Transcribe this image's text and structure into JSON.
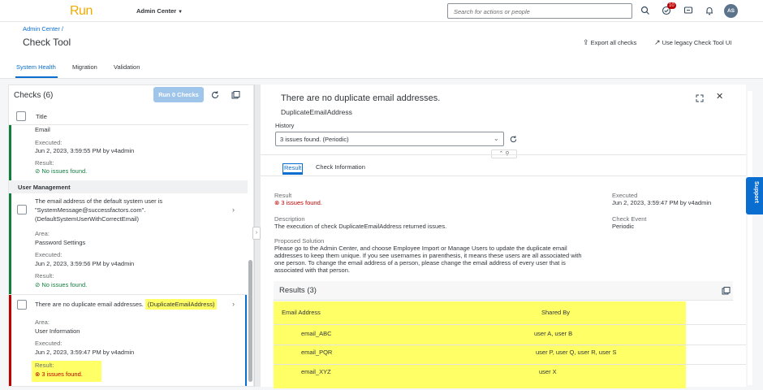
{
  "shell": {
    "logo": "Run",
    "menu": "Admin Center",
    "search_placeholder": "Search for actions or people",
    "notif_count": "10",
    "avatar": "AS"
  },
  "header": {
    "breadcrumb": "Admin Center /",
    "title": "Check Tool",
    "export_label": "Export all checks",
    "legacy_label": "Use legacy Check Tool UI"
  },
  "tabs": [
    "System Health",
    "Migration",
    "Validation"
  ],
  "left": {
    "title": "Checks (6)",
    "run_label": "Run 0 Checks",
    "col_title": "Title",
    "group": "User Management",
    "items": [
      {
        "title": "Email",
        "executed_label": "Executed:",
        "executed": "Jun 2, 2023, 3:59:55 PM by v4admin",
        "result_label": "Result:",
        "result": "No issues found."
      },
      {
        "title_1": "The email address of the default system user is",
        "title_2": "\"SystemMessage@successfactors.com\".",
        "title_3": "(DefaultSystemUserWithCorrectEmail)",
        "area_label": "Area:",
        "area": "Password Settings",
        "executed_label": "Executed:",
        "executed": "Jun 2, 2023, 3:59:56 PM by v4admin",
        "result_label": "Result:",
        "result": "No issues found."
      },
      {
        "title": "There are no duplicate email addresses.",
        "code": "(DuplicateEmailAddress)",
        "area_label": "Area:",
        "area": "User Information",
        "executed_label": "Executed:",
        "executed": "Jun 2, 2023, 3:59:47 PM by v4admin",
        "result_label": "Result:",
        "result": "3 issues found."
      }
    ]
  },
  "detail": {
    "title": "There are no duplicate email addresses.",
    "subtitle": "DuplicateEmailAddress",
    "history_label": "History",
    "history_value": "3 issues found. (Periodic)",
    "tabs": [
      "Result",
      "Check Information"
    ],
    "result_label": "Result",
    "result_value": "3 issues found.",
    "executed_label": "Executed",
    "executed_value": "Jun 2, 2023, 3:59:47 PM by v4admin",
    "description_label": "Description",
    "description_value": "The execution of check DuplicateEmailAddress returned issues.",
    "event_label": "Check Event",
    "event_value": "Periodic",
    "solution_label": "Proposed Solution",
    "solution_lines": [
      "Please go to the Admin Center, and choose Employee Import or Manage Users to update the duplicate email",
      "addresses to keep them unique. If you see usernames in parenthesis, it means these users are all associated with",
      "one person. To change the email address of a person, please change the email address of every user that is",
      "associated with that person."
    ],
    "results_title": "Results (3)",
    "columns": [
      "Email Address",
      "Shared By"
    ],
    "rows": [
      {
        "email": "email_ABC",
        "shared": "user A, user B"
      },
      {
        "email": "email_PQR",
        "shared": "user P, user Q, user R, user S"
      },
      {
        "email": "email_XYZ",
        "shared": "user X"
      }
    ]
  },
  "support_label": "Support",
  "colors": {
    "accent": "#0a6ed1",
    "error": "#bb0000",
    "success": "#107e3e",
    "highlight": "#ffff66"
  }
}
